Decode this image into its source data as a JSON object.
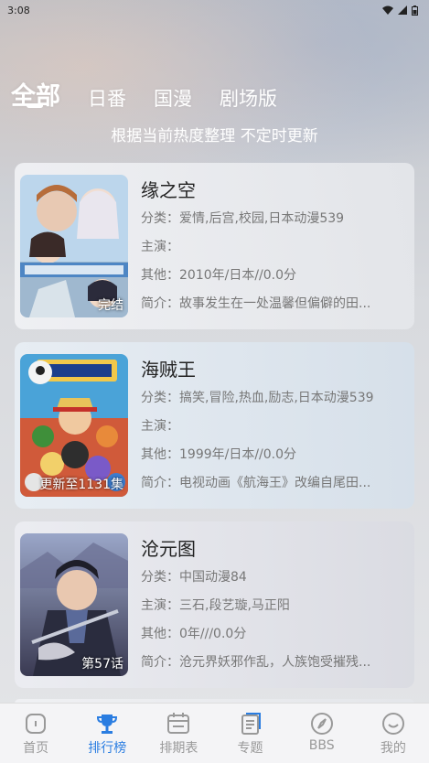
{
  "status_bar": {
    "time": "3:08"
  },
  "tabs": [
    {
      "label": "全部",
      "active": true
    },
    {
      "label": "日番",
      "active": false
    },
    {
      "label": "国漫",
      "active": false
    },
    {
      "label": "剧场版",
      "active": false
    }
  ],
  "subtitle": "根据当前热度整理 不定时更新",
  "items": [
    {
      "title": "缘之空",
      "category": "分类：爱情,后宫,校园,日本动漫539",
      "cast": "主演：",
      "other": "其他：2010年/日本//0.0分",
      "summary": "简介：故事发生在一处温馨但偏僻的田...",
      "badge": "完结"
    },
    {
      "title": "海贼王",
      "category": "分类：搞笑,冒险,热血,励志,日本动漫539",
      "cast": "主演：",
      "other": "其他：1999年/日本//0.0分",
      "summary": "简介：电视动画《航海王》改编自尾田...",
      "badge": "更新至1131集"
    },
    {
      "title": "沧元图",
      "category": "分类：中国动漫84",
      "cast": "主演：三石,段艺璇,马正阳",
      "other": "其他：0年///0.0分",
      "summary": "简介：沧元界妖邪作乱，人族饱受摧残...",
      "badge": "第57话"
    }
  ],
  "nav": [
    {
      "label": "首页",
      "icon": "home-icon",
      "active": false
    },
    {
      "label": "排行榜",
      "icon": "trophy-icon",
      "active": true
    },
    {
      "label": "排期表",
      "icon": "calendar-icon",
      "active": false
    },
    {
      "label": "专题",
      "icon": "document-icon",
      "active": false
    },
    {
      "label": "BBS",
      "icon": "compass-icon",
      "active": false
    },
    {
      "label": "我的",
      "icon": "smile-icon",
      "active": false
    }
  ],
  "colors": {
    "accent": "#2a7de1",
    "inactive": "#999999"
  }
}
